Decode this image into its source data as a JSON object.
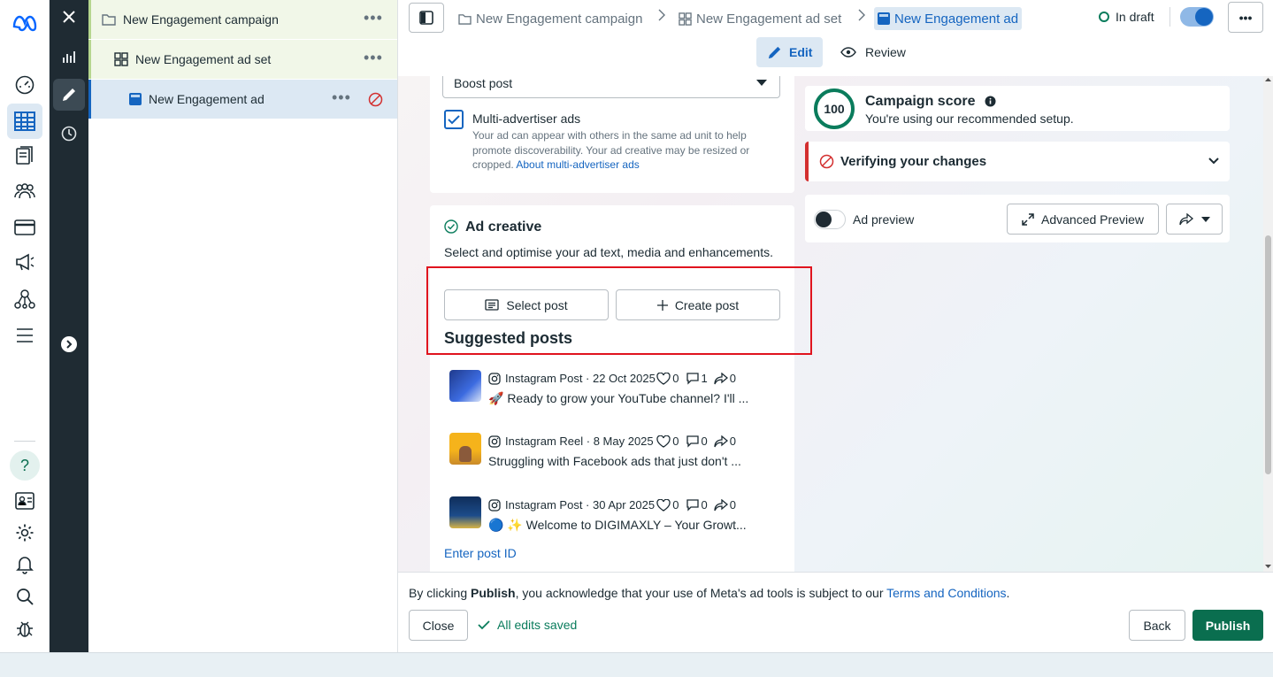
{
  "brand": {
    "logo": "meta-logo"
  },
  "rail": {
    "icons": [
      "meta-logo",
      "bar-chart-icon",
      "gauge-icon",
      "grid-table-icon",
      "pages-icon",
      "people-icon",
      "credit-card-icon",
      "megaphone-icon",
      "network-icon",
      "menu-icon",
      "help-icon",
      "contact-card-icon",
      "gear-icon",
      "bell-icon",
      "search-icon",
      "bug-icon"
    ]
  },
  "tree": {
    "campaign": "New Engagement campaign",
    "adset": "New Engagement ad set",
    "ad": "New Engagement ad",
    "more": "•••"
  },
  "header": {
    "crumbs": [
      "New Engagement campaign",
      "New Engagement ad set",
      "New Engagement ad"
    ],
    "status": "In draft",
    "more": "•••",
    "tabs": {
      "edit": "Edit",
      "review": "Review"
    }
  },
  "left_col": {
    "dropdown_value": "Boost post",
    "multi_adv": {
      "title": "Multi-advertiser ads",
      "desc_line1": "Your ad can appear with others in the same ad unit to help",
      "desc_line2": "promote discoverability. Your ad creative may be resized or",
      "desc_line3": "cropped.",
      "link": "About multi-advertiser ads",
      "checked": true
    },
    "creative": {
      "title": "Ad creative",
      "desc": "Select and optimise your ad text, media and enhancements.",
      "select_post": "Select post",
      "create_post": "Create post",
      "suggested_title": "Suggested posts",
      "posts": [
        {
          "meta": "Instagram Post · 22 Oct 2025",
          "likes": "0",
          "comments": "1",
          "shares": "0",
          "text": "🚀 Ready to grow your YouTube channel? I'll ..."
        },
        {
          "meta": "Instagram Reel · 8 May 2025",
          "likes": "0",
          "comments": "0",
          "shares": "0",
          "text": "Struggling with Facebook ads that just don't ..."
        },
        {
          "meta": "Instagram Post · 30 Apr 2025",
          "likes": "0",
          "comments": "0",
          "shares": "0",
          "text": "🔵 ✨ Welcome to DIGIMAXLY – Your Growt..."
        }
      ],
      "enter_post_id": "Enter post ID"
    }
  },
  "right_col": {
    "score": {
      "value": "100",
      "title": "Campaign score",
      "subtitle": "You're using our recommended setup."
    },
    "verify": "Verifying your changes",
    "preview": {
      "label": "Ad preview",
      "advanced": "Advanced Preview"
    }
  },
  "footer": {
    "notice_prefix": "By clicking ",
    "notice_bold": "Publish",
    "notice_mid": ", you acknowledge that your use of Meta's ad tools is subject to our ",
    "notice_link": "Terms and Conditions",
    "notice_end": ".",
    "close": "Close",
    "saved": "All edits saved",
    "back": "Back",
    "publish": "Publish"
  },
  "colors": {
    "accent": "#1877f2",
    "publish": "#0a6e4f",
    "highlight_box": "#e0141e",
    "draft": "#0a7c5c"
  }
}
